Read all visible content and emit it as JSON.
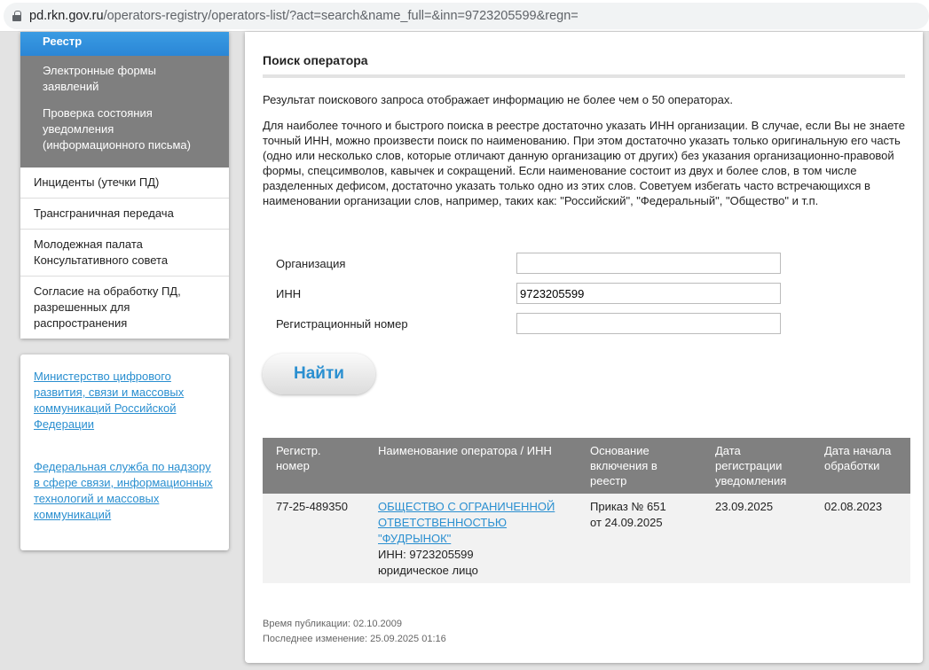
{
  "browser": {
    "url_host": "pd.rkn.gov.ru",
    "url_path": "/operators-registry/operators-list/?act=search&name_full=&inn=9723205599&regn="
  },
  "sidebar": {
    "active": "Реестр",
    "sub": [
      "Электронные формы заявлений",
      "Проверка состояния уведомления (информационного письма)"
    ],
    "items": [
      "Инциденты (утечки ПД)",
      "Трансграничная передача",
      "Молодежная палата Консультативного совета",
      "Согласие на обработку ПД, разрешенных для распространения"
    ],
    "links": [
      "Министерство цифрового развития, связи и массовых коммуникаций Российской Федерации",
      "Федеральная служба по надзору в сфере связи, информационных технологий и массовых коммуникаций"
    ]
  },
  "main": {
    "title": "Поиск оператора",
    "p1": "Результат поискового запроса отображает информацию не более чем о 50 операторах.",
    "p2": "Для наиболее точного и быстрого поиска в реестре достаточно указать ИНН организации. В случае, если Вы не знаете точный ИНН, можно произвести поиск по наименованию. При этом достаточно указать только оригинальную его часть (одно или несколько слов, которые отличают данную организацию от других) без указания организационно-правовой формы, спецсимволов, кавычек и сокращений. Если наименование состоит из двух и более слов, в том числе разделенных дефисом, достаточно указать только одно из этих слов. Советуем избегать часто встречающихся в наименовании организации слов, например, таких как: \"Российский\", \"Федеральный\", \"Общество\" и т.п.",
    "form": {
      "org_label": "Организация",
      "org_value": "",
      "inn_label": "ИНН",
      "inn_value": "9723205599",
      "reg_label": "Регистрационный номер",
      "reg_value": "",
      "submit": "Найти"
    },
    "table": {
      "headers": [
        "Регистр. номер",
        "Наименование оператора / ИНН",
        "Основание включения в реестр",
        "Дата регистрации уведомления",
        "Дата начала обработки"
      ],
      "rows": [
        {
          "reg": "77-25-489350",
          "name": "ОБЩЕСТВО С ОГРАНИЧЕННОЙ ОТВЕТСТВЕННОСТЬЮ \"ФУДРЫНОК\"",
          "inn": "ИНН: 9723205599",
          "type": "юридическое лицо",
          "basis1": "Приказ № 651",
          "basis2": "от 24.09.2025",
          "reg_date": "23.09.2025",
          "start_date": "02.08.2023"
        }
      ]
    },
    "published": "Время публикации: 02.10.2009",
    "modified": "Последнее изменение: 25.09.2025 01:16"
  }
}
